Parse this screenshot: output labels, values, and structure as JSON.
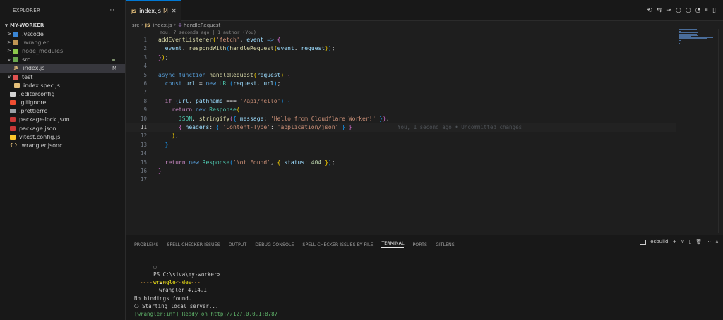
{
  "explorer": {
    "title": "EXPLORER",
    "more": "···",
    "root": "MY-WORKER",
    "items": [
      {
        "label": ".vscode",
        "chevron": ">",
        "icon": "vscode-folder-icon",
        "color": "#3a86d6",
        "indent": 8,
        "dim": false
      },
      {
        "label": ".wrangler",
        "chevron": ">",
        "icon": "folder-icon",
        "color": "#c09553",
        "indent": 8,
        "dim": true
      },
      {
        "label": "node_modules",
        "chevron": ">",
        "icon": "node-folder-icon",
        "color": "#8cc84b",
        "indent": 8,
        "dim": true
      },
      {
        "label": "src",
        "chevron": "∨",
        "icon": "src-folder-icon",
        "color": "#6aa84f",
        "indent": 8,
        "dim": false,
        "dot": true
      },
      {
        "label": "index.js",
        "chevron": "",
        "icon": "js-file-icon",
        "color": "#e5c07b",
        "indent": 20,
        "badge": "M",
        "selected": true,
        "iconText": "JS"
      },
      {
        "label": "test",
        "chevron": "∨",
        "icon": "test-folder-icon",
        "color": "#e05252",
        "indent": 8,
        "dim": false
      },
      {
        "label": "index.spec.js",
        "chevron": "",
        "icon": "test-js-icon",
        "color": "#e5c07b",
        "indent": 20
      },
      {
        "label": ".editorconfig",
        "chevron": "",
        "icon": "gear-file-icon",
        "color": "#d4d4d4",
        "indent": 14
      },
      {
        "label": ".gitignore",
        "chevron": "",
        "icon": "git-icon",
        "color": "#f14e32",
        "indent": 14
      },
      {
        "label": ".prettierrc",
        "chevron": "",
        "icon": "prettier-icon",
        "color": "#9aa0a6",
        "indent": 14
      },
      {
        "label": "package-lock.json",
        "chevron": "",
        "icon": "npm-icon",
        "color": "#cb3837",
        "indent": 14
      },
      {
        "label": "package.json",
        "chevron": "",
        "icon": "npm-icon",
        "color": "#cb3837",
        "indent": 14
      },
      {
        "label": "vitest.config.js",
        "chevron": "",
        "icon": "vitest-icon",
        "color": "#fcc72b",
        "indent": 14
      },
      {
        "label": "wrangler.jsonc",
        "chevron": "",
        "icon": "braces-icon",
        "color": "#e5c07b",
        "indent": 14,
        "iconText": "{ }"
      }
    ]
  },
  "tab": {
    "badge": "JS",
    "label": "index.js",
    "modified": "M",
    "close": "✕"
  },
  "editor_actions": [
    "⟲",
    "⇆",
    "⊸",
    "○",
    "○",
    "◔",
    "⏸",
    "▯"
  ],
  "breadcrumb": {
    "parts": [
      "src",
      "JS",
      "index.js",
      "⊚",
      "handleRequest"
    ],
    "sep": "›"
  },
  "codelens": "You, 7 seconds ago | 1 author (You)",
  "current_line": 11,
  "blame": "You, 1 second ago • Uncommitted changes",
  "code_lines": [
    [
      [
        "fn",
        "addEventListener"
      ],
      [
        "p1",
        "("
      ],
      [
        "str",
        "'fetch'"
      ],
      [
        "",
        ", "
      ],
      [
        "var",
        "event"
      ],
      [
        "kw",
        " =>"
      ],
      [
        "p2",
        " {"
      ]
    ],
    [
      [
        "",
        "  "
      ],
      [
        "var",
        "event"
      ],
      [
        "",
        ". "
      ],
      [
        "fn",
        "respondWith"
      ],
      [
        "p3",
        "("
      ],
      [
        "fn",
        "handleRequest"
      ],
      [
        "p1",
        "("
      ],
      [
        "var",
        "event"
      ],
      [
        "",
        ". "
      ],
      [
        "var",
        "request"
      ],
      [
        "p1",
        ")"
      ],
      [
        "p3",
        ")"
      ],
      [
        "",
        ";"
      ]
    ],
    [
      [
        "p2",
        "}"
      ],
      [
        "p1",
        ")"
      ],
      [
        "",
        ";"
      ]
    ],
    [],
    [
      [
        "kw",
        "async function "
      ],
      [
        "fn",
        "handleRequest"
      ],
      [
        "p1",
        "("
      ],
      [
        "var",
        "request"
      ],
      [
        "p1",
        ")"
      ],
      [
        "p2",
        " {"
      ]
    ],
    [
      [
        "",
        "  "
      ],
      [
        "kw",
        "const "
      ],
      [
        "var",
        "url"
      ],
      [
        "",
        " = "
      ],
      [
        "kw",
        "new "
      ],
      [
        "cls",
        "URL"
      ],
      [
        "p3",
        "("
      ],
      [
        "var",
        "request"
      ],
      [
        "",
        ". "
      ],
      [
        "var",
        "url"
      ],
      [
        "p3",
        ")"
      ],
      [
        "",
        ";"
      ]
    ],
    [],
    [
      [
        "",
        "  "
      ],
      [
        "kw2",
        "if "
      ],
      [
        "p3",
        "("
      ],
      [
        "var",
        "url"
      ],
      [
        "",
        ". "
      ],
      [
        "var",
        "pathname"
      ],
      [
        "",
        " === "
      ],
      [
        "str",
        "'/api/hello'"
      ],
      [
        "p3",
        ")"
      ],
      [
        "p3",
        " {"
      ]
    ],
    [
      [
        "",
        "    "
      ],
      [
        "kw2",
        "return "
      ],
      [
        "kw",
        "new "
      ],
      [
        "cls",
        "Response"
      ],
      [
        "p1",
        "("
      ]
    ],
    [
      [
        "",
        "      "
      ],
      [
        "cls",
        "JSON"
      ],
      [
        "",
        ". "
      ],
      [
        "fn",
        "stringify"
      ],
      [
        "p2",
        "("
      ],
      [
        "p3",
        "{ "
      ],
      [
        "var",
        "message"
      ],
      [
        "",
        ": "
      ],
      [
        "str",
        "'Hello from Cloudflare Worker!'"
      ],
      [
        "p3",
        " }"
      ],
      [
        "p2",
        ")"
      ],
      [
        "",
        ","
      ]
    ],
    [
      [
        "",
        "      "
      ],
      [
        "p2",
        "{ "
      ],
      [
        "var",
        "headers"
      ],
      [
        "",
        ": "
      ],
      [
        "p3",
        "{ "
      ],
      [
        "str",
        "'Content-Type'"
      ],
      [
        "",
        ": "
      ],
      [
        "str",
        "'application/json'"
      ],
      [
        "p3",
        " }"
      ],
      [
        "p2",
        " }"
      ]
    ],
    [
      [
        "",
        "    "
      ],
      [
        "p1",
        ")"
      ],
      [
        "",
        ";"
      ]
    ],
    [
      [
        "",
        "  "
      ],
      [
        "p3",
        "}"
      ]
    ],
    [],
    [
      [
        "",
        "  "
      ],
      [
        "kw2",
        "return "
      ],
      [
        "kw",
        "new "
      ],
      [
        "cls",
        "Response"
      ],
      [
        "p3",
        "("
      ],
      [
        "str",
        "'Not Found'"
      ],
      [
        "",
        ", "
      ],
      [
        "p1",
        "{ "
      ],
      [
        "var",
        "status"
      ],
      [
        "",
        ": "
      ],
      [
        "num",
        "404"
      ],
      [
        "p1",
        " }"
      ],
      [
        "p3",
        ")"
      ],
      [
        "",
        ";"
      ]
    ],
    [
      [
        "p2",
        "}"
      ]
    ],
    []
  ],
  "panel": {
    "tabs": [
      "PROBLEMS",
      "SPELL CHECKER ISSUES",
      "OUTPUT",
      "DEBUG CONSOLE",
      "SPELL CHECKER ISSUES BY FILE",
      "TERMINAL",
      "PORTS",
      "GITLENS"
    ],
    "active_tab": "TERMINAL",
    "term_name": "esbuild",
    "actions": [
      "+",
      "∨",
      "▯",
      "🗑",
      "···",
      "∧"
    ]
  },
  "terminal": {
    "prompt_circle": "○",
    "prompt": "PS C:\\siva\\my-worker>",
    "command": "wrangler dev",
    "banner_icon": "☁",
    "banner": "wrangler 4.14.1",
    "rule": "-------------------",
    "line1": "No bindings found.",
    "line2": "⎔ Starting local server...",
    "line3": "[wrangler:inf] Ready on http://127.0.0.1:8787"
  }
}
